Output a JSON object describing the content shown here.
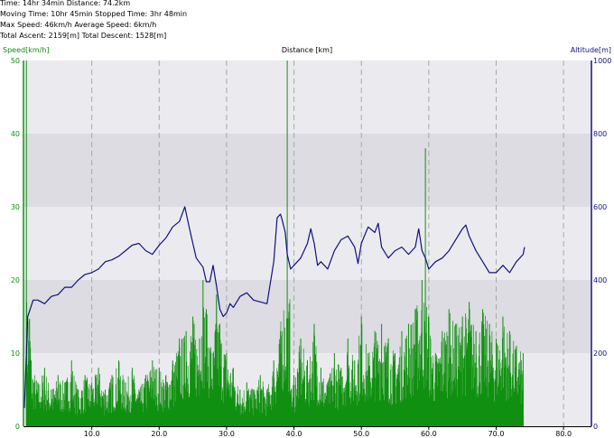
{
  "stats": [
    "Time: 14hr 34min  Distance: 74.2km",
    "Moving Time: 10hr 45min  Stopped Time: 3hr 48min",
    "Max Speed: 46km/h  Average Speed: 6km/h",
    "Total Ascent: 2159[m]  Total Descent: 1528[m]"
  ],
  "chart_data": {
    "type": "line",
    "xlabel": "Distance [km]",
    "ylabel_left": "Speed[km/h]",
    "ylabel_right": "Altitude[m]",
    "xlim": [
      0,
      84
    ],
    "ylim_left": [
      0,
      50
    ],
    "ylim_right": [
      0,
      1000
    ],
    "x_ticks": [
      "10.0",
      "20.0",
      "30.0",
      "40.0",
      "50.0",
      "60.0",
      "70.0",
      "80.0"
    ],
    "y_ticks_left": [
      "0",
      "10",
      "20",
      "30",
      "40",
      "50"
    ],
    "y_ticks_right": [
      "0",
      "200",
      "400",
      "600",
      "800",
      "1000"
    ],
    "grid": true,
    "colors": {
      "speed": "#109010",
      "altitude": "#101080",
      "band_dark": "#dcdce2",
      "band_light": "#ebebef"
    },
    "series": [
      {
        "name": "Altitude[m]",
        "axis": "right",
        "x": [
          0,
          0.5,
          1.3,
          2,
          3,
          4,
          5,
          6,
          7,
          8,
          9,
          10,
          11,
          12,
          13,
          14,
          15,
          16,
          17,
          18,
          19,
          20,
          21,
          22,
          23,
          23.8,
          24.5,
          25.5,
          26.5,
          27,
          27.5,
          28,
          28.5,
          29,
          29.5,
          30,
          30.5,
          31,
          32,
          33,
          34,
          35,
          36,
          37,
          37.5,
          38,
          38.3,
          38.7,
          39,
          39.5,
          40,
          41,
          42,
          42.5,
          43,
          43.5,
          44,
          45,
          46,
          47,
          48,
          49,
          49.5,
          50,
          51,
          52,
          52.5,
          53,
          54,
          55,
          56,
          57,
          58,
          58.5,
          59,
          59.5,
          60,
          61,
          62,
          63,
          64,
          65,
          65.5,
          66,
          67,
          68,
          69,
          70,
          71,
          72,
          73,
          74,
          74.2
        ],
        "values": [
          50,
          300,
          345,
          345,
          335,
          355,
          360,
          380,
          380,
          400,
          415,
          420,
          430,
          450,
          455,
          465,
          480,
          495,
          500,
          480,
          470,
          495,
          515,
          545,
          560,
          600,
          540,
          460,
          435,
          395,
          395,
          440,
          385,
          320,
          300,
          310,
          335,
          325,
          355,
          365,
          345,
          340,
          335,
          450,
          570,
          580,
          560,
          530,
          470,
          430,
          440,
          460,
          500,
          540,
          500,
          440,
          450,
          430,
          480,
          510,
          520,
          490,
          445,
          500,
          545,
          530,
          555,
          490,
          460,
          480,
          490,
          470,
          490,
          540,
          480,
          460,
          430,
          450,
          460,
          480,
          510,
          540,
          550,
          520,
          480,
          450,
          420,
          420,
          440,
          420,
          450,
          470,
          490
        ]
      },
      {
        "name": "Speed[km/h]",
        "axis": "left",
        "x": [
          0.3,
          1.0,
          2.0,
          3.0,
          4.0,
          5.0,
          6.0,
          7.0,
          8.0,
          9.0,
          10.0,
          11.0,
          12.0,
          13.0,
          14.0,
          15.0,
          16.0,
          17.0,
          18.0,
          19.0,
          20.0,
          21.0,
          22.0,
          23.0,
          24.0,
          25.0,
          26.0,
          26.5,
          27.0,
          28.0,
          28.5,
          29.0,
          30.0,
          31.0,
          32.0,
          33.0,
          34.0,
          35.0,
          36.0,
          37.0,
          38.0,
          39.0,
          39.6,
          40.0,
          41.0,
          42.0,
          43.0,
          44.0,
          45.0,
          46.0,
          47.0,
          48.0,
          49.0,
          50.0,
          51.0,
          52.0,
          53.0,
          54.0,
          55.0,
          56.0,
          57.0,
          58.0,
          59.0,
          59.5,
          60.0,
          61.0,
          62.0,
          63.0,
          64.0,
          65.0,
          66.0,
          67.0,
          68.0,
          69.0,
          70.0,
          71.0,
          72.0,
          73.0,
          74.0
        ],
        "values": [
          50,
          9,
          6,
          8,
          5,
          7,
          6,
          9,
          5,
          7,
          6,
          8,
          5,
          7,
          9,
          6,
          8,
          5,
          7,
          9,
          8,
          7,
          9,
          12,
          13,
          15,
          12,
          20,
          16,
          10,
          18,
          14,
          10,
          8,
          5,
          6,
          5,
          7,
          5,
          9,
          13,
          50,
          5,
          7,
          12,
          9,
          14,
          8,
          6,
          10,
          8,
          12,
          9,
          15,
          10,
          13,
          14,
          12,
          10,
          13,
          14,
          16,
          20,
          38,
          15,
          10,
          13,
          16,
          14,
          15,
          17,
          13,
          16,
          14,
          12,
          15,
          13,
          11,
          10
        ]
      }
    ]
  }
}
